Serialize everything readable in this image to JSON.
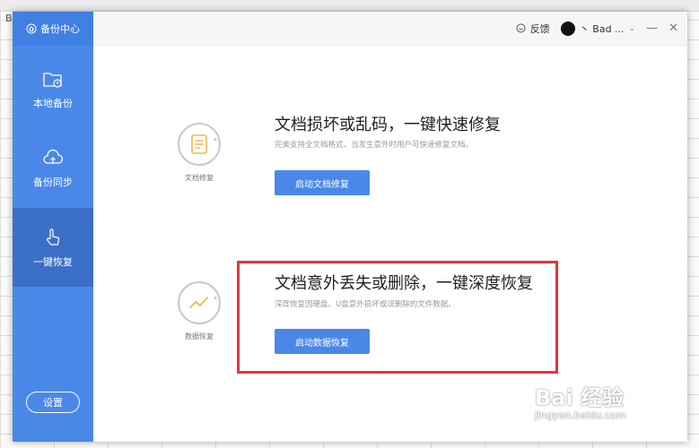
{
  "background": {
    "col_letter": "B"
  },
  "sidebar": {
    "header": "备份中心",
    "items": [
      {
        "label": "本地备份",
        "icon": "folder-clock-icon"
      },
      {
        "label": "备份同步",
        "icon": "cloud-upload-icon"
      },
      {
        "label": "一键恢复",
        "icon": "hand-pointer-icon",
        "active": true
      }
    ],
    "settings": "设置"
  },
  "titlebar": {
    "feedback": "反馈",
    "user": "丶 Bad ...",
    "minimize": "—",
    "close": "✕"
  },
  "sections": [
    {
      "icon_label": "文档修复",
      "title": "文档损坏或乱码，一键快速修复",
      "subtitle": "完美支持全文档格式，当发生意外时用户可快速修复文档。",
      "button": "启动文档修复"
    },
    {
      "icon_label": "数据恢复",
      "title": "文档意外丢失或删除，一键深度恢复",
      "subtitle": "深度恢复因硬盘、U盘意外损坏或误删除的文件数据。",
      "button": "启动数据恢复"
    }
  ],
  "watermark": {
    "main": "Bai 经验",
    "sub": "jingyan.baidu.com"
  },
  "colors": {
    "accent": "#4a88e8",
    "highlight": "#e8343c"
  }
}
